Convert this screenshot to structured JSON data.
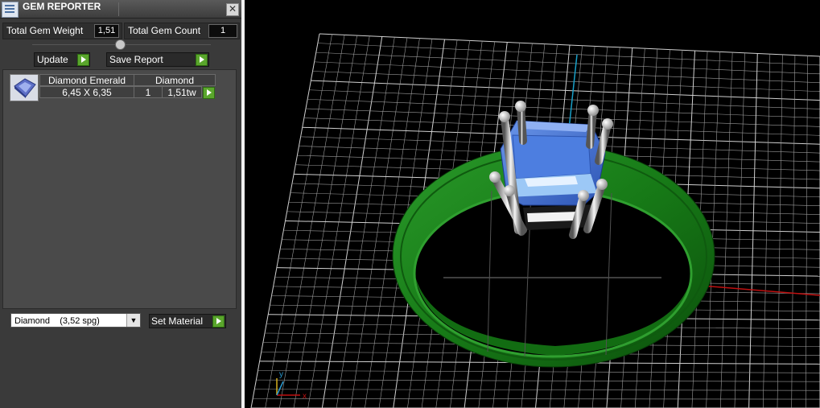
{
  "window": {
    "title": "GEM REPORTER",
    "close_glyph": "✕"
  },
  "stats": {
    "weight_label": "Total Gem Weight",
    "weight_value": "1,51",
    "count_label": "Total Gem Count",
    "count_value": "1"
  },
  "actions": {
    "update_label": "Update",
    "save_label": "Save Report"
  },
  "gems": [
    {
      "shape": "Diamond Emerald",
      "material": "Diamond",
      "size": "6,45 X 6,35",
      "count": "1",
      "weight": "1,51tw"
    }
  ],
  "material": {
    "selected": "Diamond",
    "spg": "(3,52 spg)",
    "set_label": "Set Material"
  },
  "axes": {
    "x": "x",
    "y": "y"
  },
  "icons": {
    "app": "gem-reporter-icon",
    "close": "close-icon",
    "play": "play-icon",
    "gem": "gem-thumbnail-icon",
    "dropdown": "chevron-down-icon"
  },
  "colors": {
    "ring": "#1a7a1a",
    "gem": "#4a78d6",
    "prongs": "#e8e8e8",
    "grid": "#bcbcbc",
    "x_axis": "#c01010",
    "y_axis": "#18a0c8",
    "accent_button": "#5aa62c"
  }
}
